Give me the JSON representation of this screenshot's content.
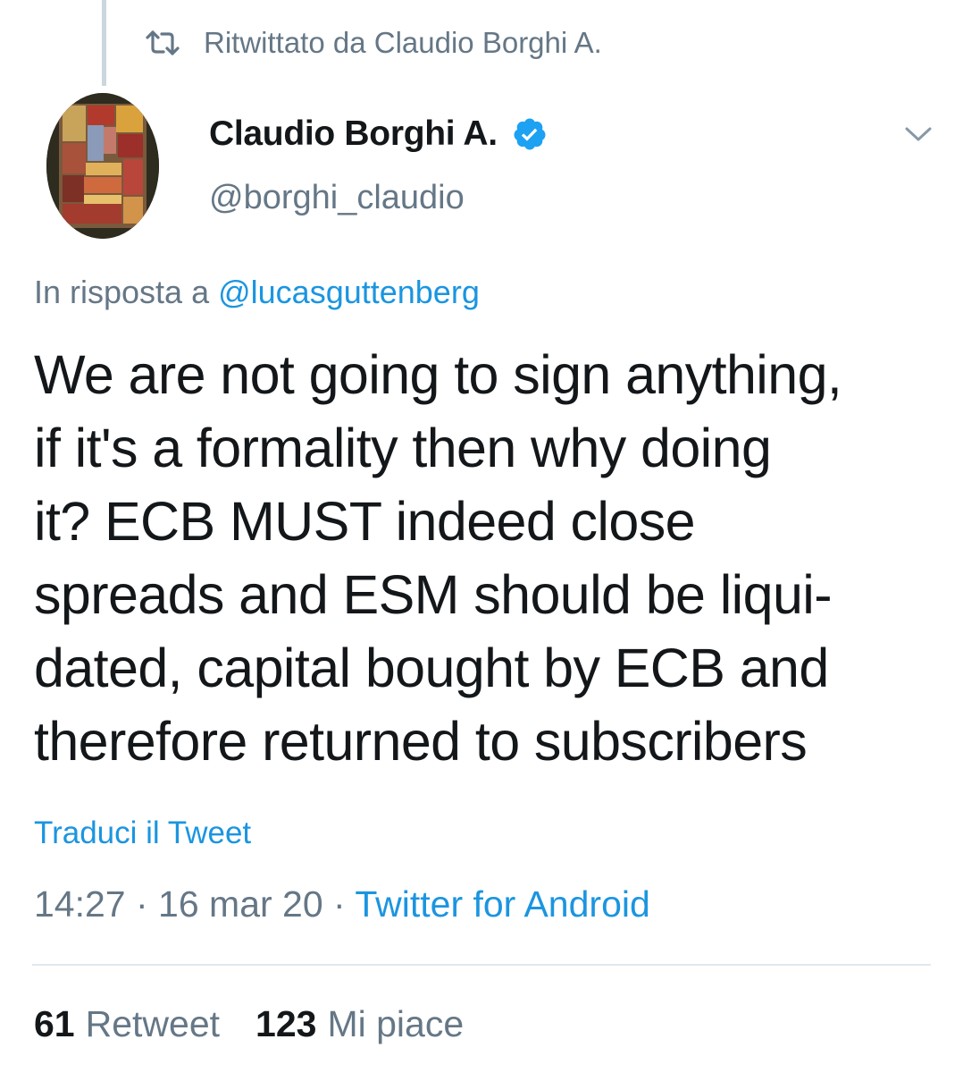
{
  "retweet_banner": {
    "icon": "retweet-icon",
    "text": "Ritwittato da Claudio Borghi A."
  },
  "author": {
    "display_name": "Claudio Borghi A.",
    "verified": true,
    "handle": "@borghi_claudio"
  },
  "reply": {
    "prefix": "In risposta a ",
    "mention": "@lucasguttenberg"
  },
  "tweet": {
    "lines": [
      "We are not going to sign anything,",
      "if it's a formality then why doing",
      "it? ECB MUST indeed close",
      "spreads and ESM should be liqui-",
      "dated, capital bought by ECB and",
      "therefore returned to subscribers"
    ]
  },
  "translate_label": "Traduci il Tweet",
  "meta": {
    "time": "14:27",
    "date": "16 mar 20",
    "source": "Twitter for Android"
  },
  "stats": {
    "retweets_count": "61",
    "retweets_label": "Retweet",
    "likes_count": "123",
    "likes_label": "Mi piace"
  },
  "colors": {
    "link": "#1b95e0",
    "secondary_text": "#657786",
    "primary_text": "#14171a",
    "verified_badge": "#1da1f2"
  }
}
